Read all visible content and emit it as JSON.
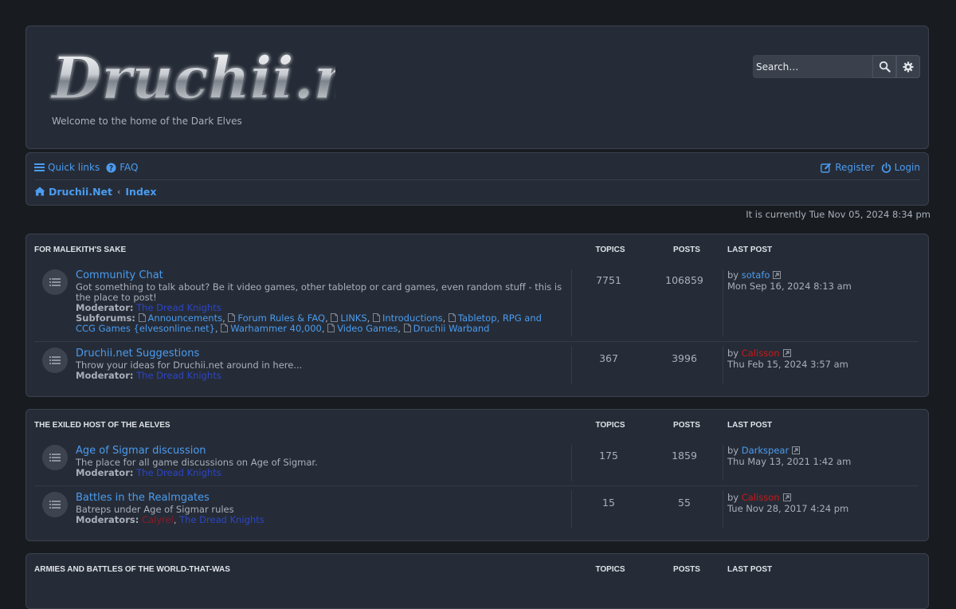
{
  "header": {
    "site_name": "Druchii.net",
    "tagline": "Welcome to the home of the Dark Elves",
    "search_placeholder": "Search…"
  },
  "nav": {
    "quick_links": "Quick links",
    "faq": "FAQ",
    "register": "Register",
    "login": "Login",
    "breadcrumb_home": "Druchii.Net",
    "breadcrumb_index": "Index"
  },
  "current_time": "It is currently Tue Nov 05, 2024 8:34 pm",
  "columns": {
    "topics": "TOPICS",
    "posts": "POSTS",
    "last_post": "LAST POST"
  },
  "labels": {
    "moderator": "Moderator:",
    "moderators": "Moderators:",
    "subforums": "Subforums:",
    "by": "by"
  },
  "categories": [
    {
      "name": "FOR MALEKITH'S SAKE",
      "forums": [
        {
          "title": "Community Chat",
          "description": "Got something to talk about? Be it video games, other tabletop or card games, even random stuff - this is the place to post!",
          "moderator": "The Dread Knights",
          "subforums": [
            "Announcements",
            "Forum Rules & FAQ",
            "LINKS",
            "Introductions",
            "Tabletop, RPG and CCG Games {elvesonline.net}",
            "Warhammer 40,000",
            "Video Games",
            "Druchii Warband"
          ],
          "topics": "7751",
          "posts": "106859",
          "last_user": "sotafo",
          "last_date": "Mon Sep 16, 2024 8:13 am"
        },
        {
          "title": "Druchii.net Suggestions",
          "description": "Throw your ideas for Druchii.net around in here...",
          "moderator": "The Dread Knights",
          "topics": "367",
          "posts": "3996",
          "last_user": "Calisson",
          "last_date": "Thu Feb 15, 2024 3:57 am"
        }
      ]
    },
    {
      "name": "THE EXILED HOST OF THE AELVES",
      "forums": [
        {
          "title": "Age of Sigmar discussion",
          "description": "The place for all game discussions on Age of Sigmar.",
          "moderator": "The Dread Knights",
          "topics": "175",
          "posts": "1859",
          "last_user": "Darkspear",
          "last_date": "Thu May 13, 2021 1:42 am"
        },
        {
          "title": "Battles in the Realmgates",
          "description": "Batreps under Age of Sigmar rules",
          "moderator_red": "Calyrel",
          "moderator": "The Dread Knights",
          "topics": "15",
          "posts": "55",
          "last_user": "Calisson",
          "last_date": "Tue Nov 28, 2017 4:24 pm"
        }
      ]
    },
    {
      "name": "ARMIES AND BATTLES OF THE WORLD-THAT-WAS",
      "forums": []
    }
  ],
  "colors": {
    "background": "#181c21",
    "panel": "#262c37",
    "link": "#4a9cf0",
    "moderator": "#2b45c8",
    "admin_red": "#c81818"
  }
}
